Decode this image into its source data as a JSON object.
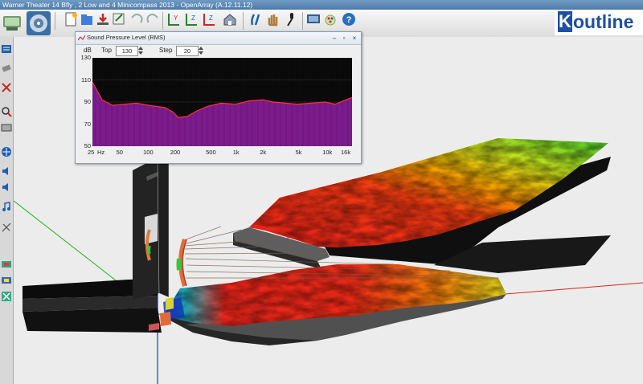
{
  "window": {
    "title": "Warner Theater 14 Bfly , 2 Low and 4 Minicompass 2013 - OpenArray (A.12.11.12)"
  },
  "toolbar": {
    "icons": [
      "speaker-icon",
      "speaker-icon",
      "new-icon",
      "open-icon",
      "save-icon",
      "undo-icon",
      "redo-icon",
      "axis-xy-icon",
      "axis-xz-icon",
      "axis-yz-icon",
      "home-icon",
      "view-icon",
      "hand-icon",
      "microphone-icon",
      "screenshot-icon",
      "paint-icon",
      "help-icon"
    ],
    "brand": "outline"
  },
  "spl_window": {
    "title": "Sound Pressure Level (RMS)",
    "db_label": "dB",
    "top_label": "Top",
    "top_value": "130",
    "step_label": "Step",
    "step_value": "20",
    "y_ticks": [
      "130",
      "110",
      "90",
      "70",
      "50"
    ],
    "x_ticks": [
      "25",
      "Hz",
      "50",
      "100",
      "200",
      "500",
      "1k",
      "2k",
      "5k",
      "10k",
      "16k"
    ],
    "colors": {
      "fill": "#7b1b8c",
      "line": "#ff3030",
      "plot_bg": "#0a0a0a"
    }
  }
}
